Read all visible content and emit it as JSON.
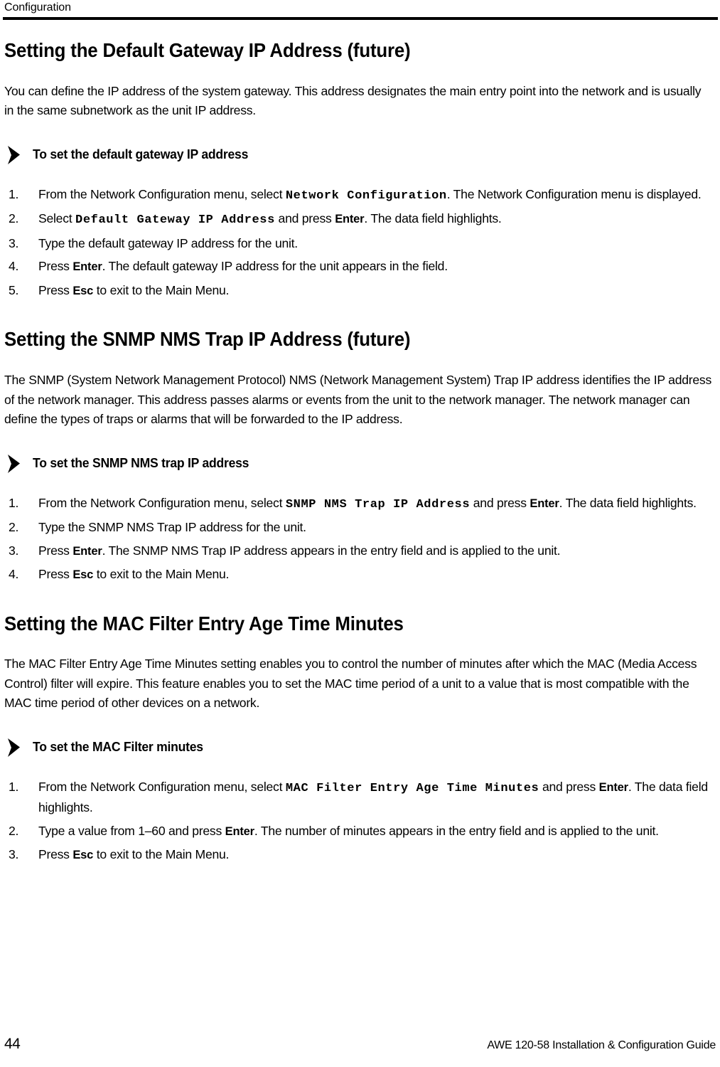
{
  "header": {
    "running_head": "Configuration"
  },
  "sections": [
    {
      "heading": "Setting the Default Gateway IP Address (future)",
      "intro": "You can define the IP address of the system gateway. This address designates the main entry point into the network and is usually in the same subnetwork as the unit IP address.",
      "procedure_title": "To set the default gateway IP address",
      "steps": [
        {
          "number": "1.",
          "parts": [
            {
              "type": "text",
              "value": "From the Network Configuration menu, select "
            },
            {
              "type": "mono",
              "value": "Network Configuration"
            },
            {
              "type": "text",
              "value": ". The Network Configuration menu is displayed."
            }
          ]
        },
        {
          "number": "2.",
          "parts": [
            {
              "type": "text",
              "value": "Select "
            },
            {
              "type": "mono",
              "value": "Default Gateway IP Address"
            },
            {
              "type": "text",
              "value": " and press "
            },
            {
              "type": "kbd",
              "value": "Enter"
            },
            {
              "type": "text",
              "value": ". The data field highlights."
            }
          ]
        },
        {
          "number": "3.",
          "parts": [
            {
              "type": "text",
              "value": "Type the default gateway IP address for the unit."
            }
          ]
        },
        {
          "number": "4.",
          "parts": [
            {
              "type": "text",
              "value": "Press "
            },
            {
              "type": "kbd",
              "value": "Enter"
            },
            {
              "type": "text",
              "value": ". The default gateway IP address for the unit appears in the field."
            }
          ]
        },
        {
          "number": "5.",
          "parts": [
            {
              "type": "text",
              "value": "Press "
            },
            {
              "type": "kbd",
              "value": "Esc"
            },
            {
              "type": "text",
              "value": " to exit to the Main Menu."
            }
          ]
        }
      ]
    },
    {
      "heading": "Setting the SNMP NMS Trap IP Address (future)",
      "intro": "The SNMP (System Network Management Protocol) NMS (Network Management System) Trap IP address identifies the IP address of the network manager. This address passes alarms or events from the unit to the network manager. The network manager can define the types of traps or alarms that will be forwarded to the IP address.",
      "procedure_title": "To set the SNMP NMS trap IP address",
      "steps": [
        {
          "number": "1.",
          "parts": [
            {
              "type": "text",
              "value": "From the Network Configuration menu, select "
            },
            {
              "type": "mono",
              "value": "SNMP NMS Trap IP Address"
            },
            {
              "type": "text",
              "value": " and press "
            },
            {
              "type": "kbd",
              "value": "Enter"
            },
            {
              "type": "text",
              "value": ". The data field highlights."
            }
          ]
        },
        {
          "number": "2.",
          "parts": [
            {
              "type": "text",
              "value": "Type the SNMP NMS Trap IP address for the unit."
            }
          ]
        },
        {
          "number": "3.",
          "parts": [
            {
              "type": "text",
              "value": "Press "
            },
            {
              "type": "kbd",
              "value": "Enter"
            },
            {
              "type": "text",
              "value": ". The SNMP NMS Trap IP address appears in the entry field and is applied to the unit."
            }
          ]
        },
        {
          "number": "4.",
          "parts": [
            {
              "type": "text",
              "value": "Press "
            },
            {
              "type": "kbd",
              "value": "Esc"
            },
            {
              "type": "text",
              "value": " to exit to the Main Menu."
            }
          ]
        }
      ]
    },
    {
      "heading": "Setting the MAC Filter Entry Age Time Minutes",
      "intro": "The MAC Filter Entry Age Time Minutes setting enables you to control the number of minutes after which the MAC (Media Access Control) filter will expire. This feature enables you to set the MAC time period of a unit to a value that is most compatible with the MAC time period of other devices on a network.",
      "procedure_title": "To set the MAC Filter minutes",
      "steps": [
        {
          "number": "1.",
          "parts": [
            {
              "type": "text",
              "value": "From the Network Configuration menu, select "
            },
            {
              "type": "mono",
              "value": "MAC Filter Entry Age Time Minutes"
            },
            {
              "type": "text",
              "value": " and press "
            },
            {
              "type": "kbd",
              "value": "Enter"
            },
            {
              "type": "text",
              "value": ". The data field highlights."
            }
          ]
        },
        {
          "number": "2.",
          "parts": [
            {
              "type": "text",
              "value": "Type a value from 1–60 and press "
            },
            {
              "type": "kbd",
              "value": "Enter"
            },
            {
              "type": "text",
              "value": ". The number of minutes appears in the entry field and is applied to the unit."
            }
          ]
        },
        {
          "number": "3.",
          "parts": [
            {
              "type": "text",
              "value": "Press "
            },
            {
              "type": "kbd",
              "value": "Esc"
            },
            {
              "type": "text",
              "value": " to exit to the Main Menu."
            }
          ]
        }
      ]
    }
  ],
  "footer": {
    "page_number": "44",
    "document_title": "AWE 120-58 Installation & Configuration Guide"
  },
  "colors": {
    "text": "#000000",
    "background": "#ffffff",
    "rule": "#000000"
  }
}
